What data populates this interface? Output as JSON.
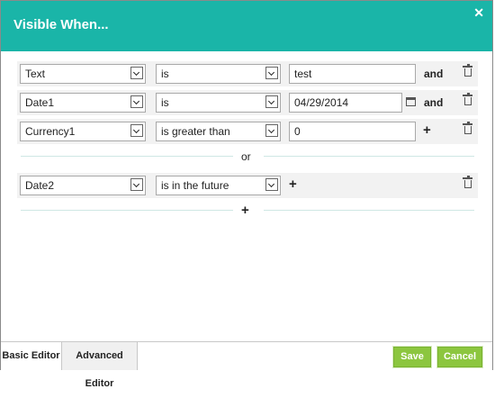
{
  "dialog": {
    "title": "Visible When...",
    "close_icon": "close-icon"
  },
  "conditions": [
    {
      "field": "Text",
      "operator": "is",
      "value": "test",
      "joiner": "and"
    },
    {
      "field": "Date1",
      "operator": "is",
      "value": "04/29/2014",
      "joiner": "and"
    },
    {
      "field": "Currency1",
      "operator": "is greater than",
      "value": "0",
      "joiner": "+"
    }
  ],
  "group_separator": "or",
  "group2": [
    {
      "field": "Date2",
      "operator": "is in the future",
      "joiner": "+"
    }
  ],
  "add_group": "+",
  "footer": {
    "tabs": [
      "Basic Editor",
      "Advanced Editor"
    ],
    "save_label": "Save",
    "cancel_label": "Cancel"
  },
  "colors": {
    "header": "#1ab5a8",
    "button": "#8cc63f"
  }
}
